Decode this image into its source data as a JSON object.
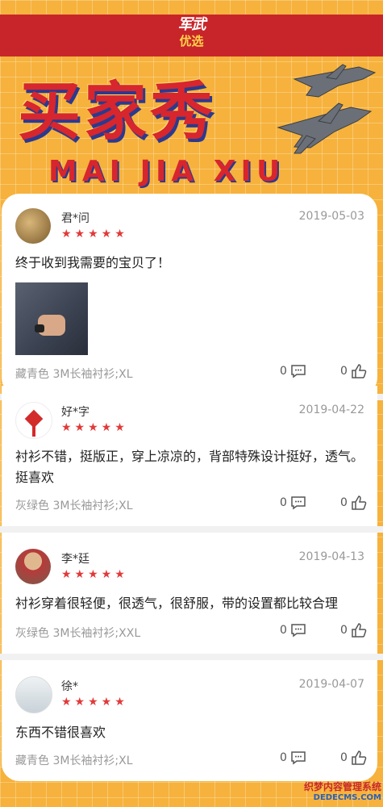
{
  "header": {
    "logo_line1": "军武",
    "logo_line2": "优选",
    "title": "买家秀",
    "subtitle": "MAI JIA XIU"
  },
  "reviews": [
    {
      "name": "君*问",
      "stars": "★★★★★",
      "date": "2019-05-03",
      "text": "终于收到我需要的宝贝了！",
      "spec": "藏青色 3M长袖衬衫;XL",
      "comments": "0",
      "likes": "0"
    },
    {
      "name": "好*字",
      "stars": "★★★★★",
      "date": "2019-04-22",
      "text": "衬衫不错，挺版正，穿上凉凉的，背部特殊设计挺好，透气。挺喜欢",
      "spec": "灰绿色 3M长袖衬衫;XL",
      "comments": "0",
      "likes": "0"
    },
    {
      "name": "李*廷",
      "stars": "★★★★★",
      "date": "2019-04-13",
      "text": "衬衫穿着很轻便，很透气，很舒服，带的设置都比较合理",
      "spec": "灰绿色 3M长袖衬衫;XXL",
      "comments": "0",
      "likes": "0"
    },
    {
      "name": "徐*",
      "stars": "★★★★★",
      "date": "2019-04-07",
      "text": "东西不错很喜欢",
      "spec": "藏青色 3M长袖衬衫;XL",
      "comments": "0",
      "likes": "0"
    }
  ],
  "watermark": {
    "line1": "织梦内容管理系统",
    "line2": "DEDECMS.COM"
  }
}
